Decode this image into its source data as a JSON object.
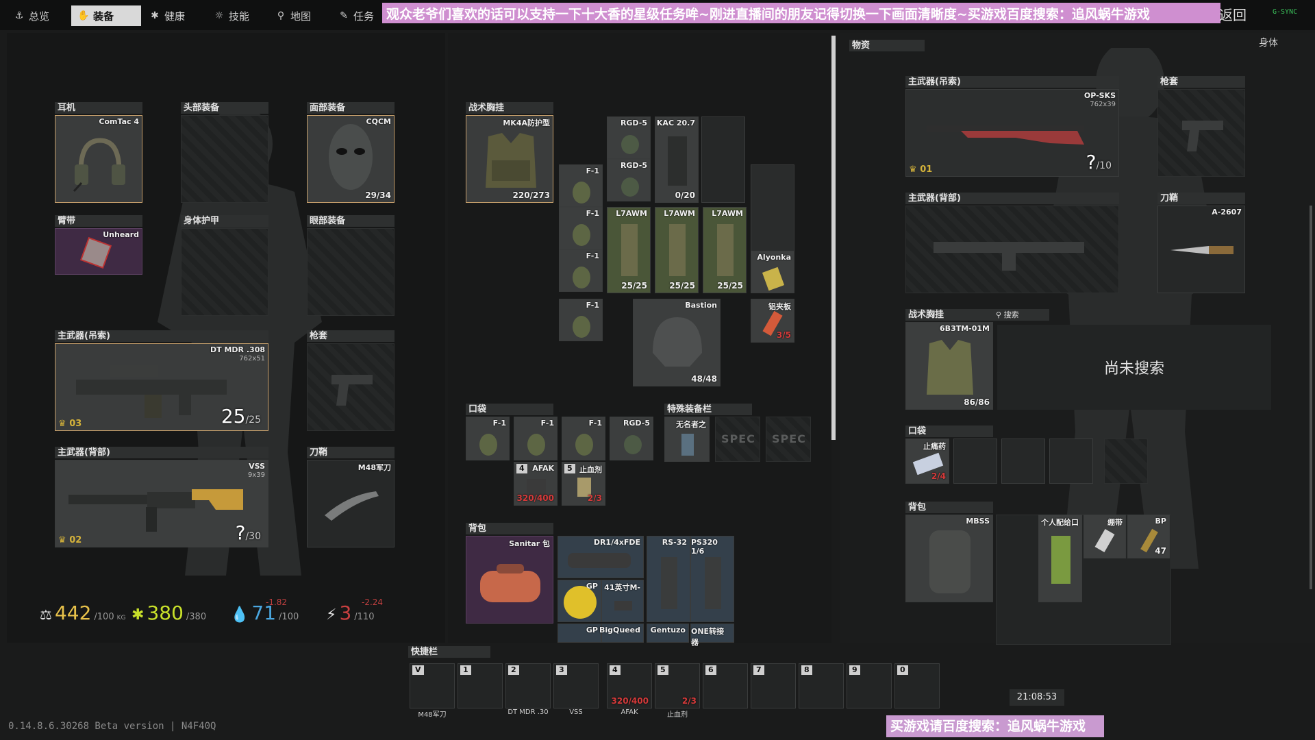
{
  "tabs": [
    {
      "label": "总览",
      "icon": "anchor-icon"
    },
    {
      "label": "装备",
      "icon": "gear-icon"
    },
    {
      "label": "健康",
      "icon": "health-icon"
    },
    {
      "label": "技能",
      "icon": "skills-icon"
    },
    {
      "label": "地图",
      "icon": "map-pin-icon"
    },
    {
      "label": "任务",
      "icon": "task-icon"
    }
  ],
  "banner": "观众老爷们喜欢的话可以支持一下十大香的星级任务哞~刚进直播间的朋友记得切换一下画面清晰度~买游戏百度搜索：追风蜗牛游戏",
  "back_label": "返回",
  "corner_status": "G-SYNC",
  "left": {
    "earpiece": {
      "header": "耳机",
      "item": "ComTac 4"
    },
    "headwear": {
      "header": "头部装备"
    },
    "face_cover": {
      "header": "面部装备",
      "item": "CQCM",
      "durability": "29/34"
    },
    "armband": {
      "header": "臂带",
      "item": "Unheard"
    },
    "body_armor": {
      "header": "身体护甲"
    },
    "eyewear": {
      "header": "眼部装备"
    },
    "primary_sling": {
      "header": "主武器(吊索)",
      "item": "DT MDR .308",
      "caliber": "762x51",
      "ammo": "25",
      "ammo_max": "/25",
      "rank": "03"
    },
    "holster": {
      "header": "枪套"
    },
    "primary_back": {
      "header": "主武器(背部)",
      "item": "VSS",
      "caliber": "9x39",
      "ammo": "?",
      "ammo_max": "/30",
      "rank": "02"
    },
    "scabbard": {
      "header": "刀鞘",
      "item": "M48军刀"
    }
  },
  "stats": {
    "weight": {
      "value": "442",
      "unit": "KG",
      "max": "/100"
    },
    "energy": {
      "value": "380",
      "max": "/380"
    },
    "hydration": {
      "value": "71",
      "max": "/100",
      "delta": "-1.82"
    },
    "stamina": {
      "value": "3",
      "max": "/110",
      "delta": "-2.24"
    }
  },
  "middle": {
    "rig": {
      "header": "战术胸挂",
      "item": "MK4A防护型",
      "durability": "220/273"
    },
    "rig_items": {
      "rgd1": "RGD-5",
      "rgd2": "RGD-5",
      "kac": "KAC 20.7",
      "kac_count": "0/20",
      "f1a": "F-1",
      "f1b": "F-1",
      "f1c": "F-1",
      "f1d": "F-1",
      "mag1": "L7AWM",
      "mag2": "L7AWM",
      "mag3": "L7AWM",
      "mag_count": "25/25",
      "alyonka": "Alyonka",
      "bastion": "Bastion",
      "bastion_dur": "48/48",
      "foil": "铝夹板",
      "foil_count": "3/5"
    },
    "pockets": {
      "header": "口袋",
      "items": [
        "F-1",
        "F-1",
        "F-1",
        "RGD-5"
      ],
      "afak": "AFAK",
      "afak_count": "320/400",
      "afak_key": "4",
      "hemo": "止血剂",
      "hemo_count": "2/3",
      "hemo_key": "5"
    },
    "special": {
      "header": "特殊装备栏",
      "item": "无名者之",
      "spec1": "SPEC",
      "spec2": "SPEC"
    },
    "backpack": {
      "header": "背包",
      "item": "Sanitar 包",
      "contents": [
        "DR1/4xFDE",
        "RS-32",
        "PS320 1/6",
        "GP",
        "41英寸M-",
        "GP",
        "BigQueed",
        "Gentuzo",
        "ONE转接器"
      ]
    }
  },
  "quickbar": {
    "header": "快捷栏",
    "slots": [
      {
        "key": "V",
        "label": "M48军刀",
        "count": ""
      },
      {
        "key": "1",
        "label": "",
        "count": ""
      },
      {
        "key": "2",
        "label": "DT MDR .30",
        "count": ""
      },
      {
        "key": "3",
        "label": "VSS",
        "count": ""
      },
      {
        "key": "4",
        "label": "AFAK",
        "count": "320/400"
      },
      {
        "key": "5",
        "label": "止血剂",
        "count": "2/3"
      },
      {
        "key": "6",
        "label": "",
        "count": ""
      },
      {
        "key": "7",
        "label": "",
        "count": ""
      },
      {
        "key": "8",
        "label": "",
        "count": ""
      },
      {
        "key": "9",
        "label": "",
        "count": ""
      },
      {
        "key": "0",
        "label": "",
        "count": ""
      }
    ]
  },
  "time": "21:08:53",
  "version": "0.14.8.6.30268 Beta version | N4F40Q",
  "footer_banner": "买游戏请百度搜索：追风蜗牛游戏",
  "right": {
    "loot_header": "物资",
    "body_label": "身体",
    "primary_sling": {
      "header": "主武器(吊索)",
      "item": "OP-SKS",
      "caliber": "762x39",
      "ammo": "?",
      "ammo_max": "/10",
      "rank": "01"
    },
    "holster": {
      "header": "枪套"
    },
    "primary_back": {
      "header": "主武器(背部)"
    },
    "scabbard": {
      "header": "刀鞘",
      "item": "A-2607"
    },
    "rig": {
      "header": "战术胸挂",
      "search_label": "搜索",
      "item": "6B3TM-01M",
      "durability": "86/86",
      "not_searched": "尚未搜索"
    },
    "pockets": {
      "header": "口袋",
      "item": "止痛药",
      "count": "2/4"
    },
    "backpack": {
      "header": "背包",
      "item": "MBSS",
      "contents": [
        "个人配给口",
        "绷带",
        "BP"
      ],
      "bp_count": "47"
    }
  }
}
